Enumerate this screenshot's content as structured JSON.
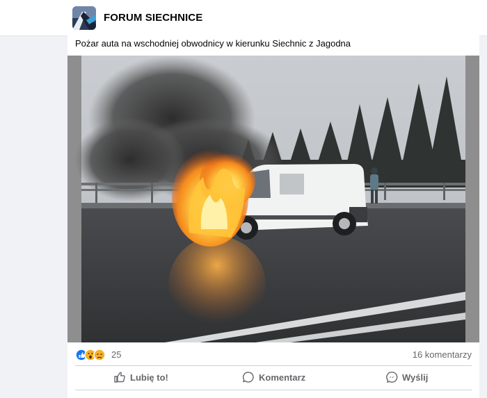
{
  "group": {
    "name": "FORUM SIECHNICE"
  },
  "post": {
    "text": "Pożar auta na wschodniej obwodnicy w kierunku Siechnic z Jagodna",
    "reactions_count": "25",
    "comments_count": "16 komentarzy",
    "reaction_icons": [
      "like-icon",
      "wow-icon",
      "sad-icon"
    ]
  },
  "actions": {
    "like_label": "Lubię to!",
    "comment_label": "Komentarz",
    "share_label": "Wyślij"
  },
  "colors": {
    "like_blue": "#1877f2",
    "reaction_yellow": "#f7b125",
    "secondary_text": "#65676b"
  }
}
